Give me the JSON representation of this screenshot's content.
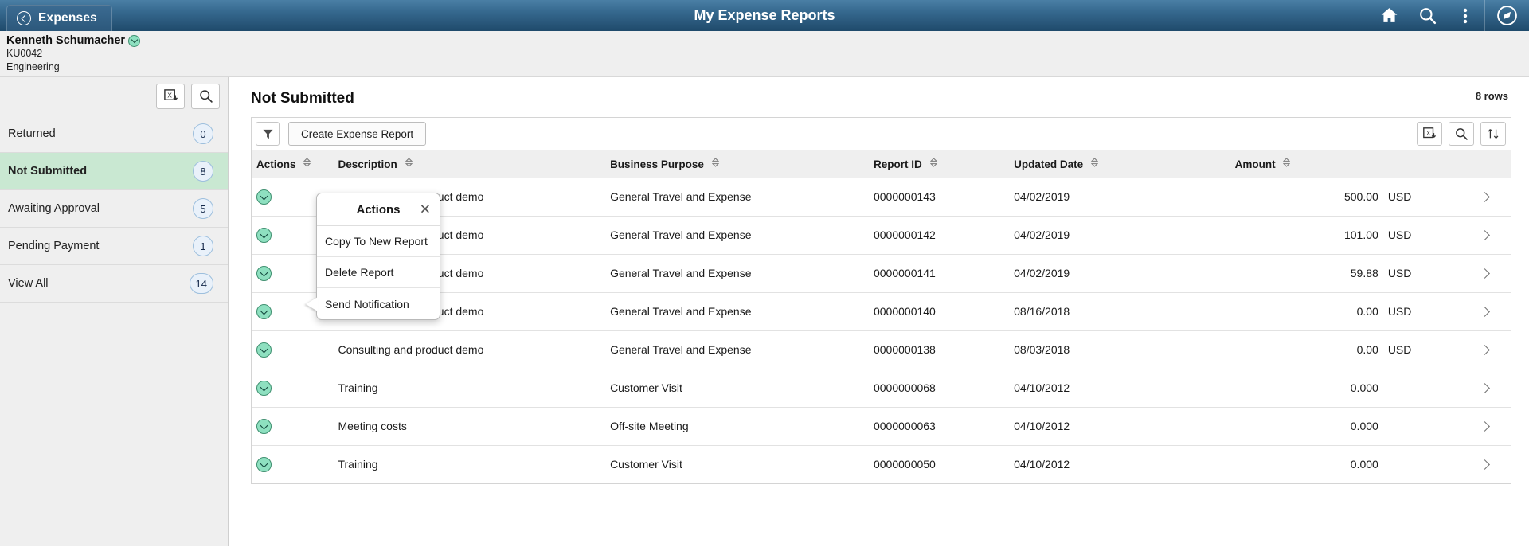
{
  "header": {
    "back_label": "Expenses",
    "title": "My Expense Reports",
    "icons": [
      "home-icon",
      "search-icon",
      "more-actions-icon",
      "navigator-icon"
    ]
  },
  "employee": {
    "name": "Kenneth Schumacher",
    "id": "KU0042",
    "department": "Engineering",
    "related_actions_icon": "related-actions-icon"
  },
  "sidebar": {
    "tools": [
      {
        "icon": "export-to-excel-icon"
      },
      {
        "icon": "search-icon"
      }
    ],
    "items": [
      {
        "label": "Returned",
        "count": "0",
        "active": false
      },
      {
        "label": "Not Submitted",
        "count": "8",
        "active": true
      },
      {
        "label": "Awaiting Approval",
        "count": "5",
        "active": false
      },
      {
        "label": "Pending Payment",
        "count": "1",
        "active": false
      },
      {
        "label": "View All",
        "count": "14",
        "active": false
      }
    ]
  },
  "main": {
    "title": "Not Submitted",
    "rows_label": "8 rows",
    "toolbar": {
      "filter_icon": "filter-funnel-icon",
      "create_label": "Create Expense Report",
      "right_icons": [
        "export-to-excel-icon",
        "search-icon",
        "sort-icon"
      ]
    },
    "columns": [
      {
        "key": "actions",
        "label": "Actions"
      },
      {
        "key": "desc",
        "label": "Description"
      },
      {
        "key": "purpose",
        "label": "Business Purpose"
      },
      {
        "key": "reportid",
        "label": "Report ID"
      },
      {
        "key": "date",
        "label": "Updated Date"
      },
      {
        "key": "amount",
        "label": "Amount"
      }
    ],
    "rows": [
      {
        "desc": "Consulting and product demo",
        "purpose": "General Travel and Expense",
        "reportid": "0000000143",
        "date": "04/02/2019",
        "amount": "500.00",
        "currency": "USD"
      },
      {
        "desc": "Consulting and product demo",
        "purpose": "General Travel and Expense",
        "reportid": "0000000142",
        "date": "04/02/2019",
        "amount": "101.00",
        "currency": "USD"
      },
      {
        "desc": "Consulting and product demo",
        "purpose": "General Travel and Expense",
        "reportid": "0000000141",
        "date": "04/02/2019",
        "amount": "59.88",
        "currency": "USD"
      },
      {
        "desc": "Consulting and product demo",
        "purpose": "General Travel and Expense",
        "reportid": "0000000140",
        "date": "08/16/2018",
        "amount": "0.00",
        "currency": "USD"
      },
      {
        "desc": "Consulting and product demo",
        "purpose": "General Travel and Expense",
        "reportid": "0000000138",
        "date": "08/03/2018",
        "amount": "0.00",
        "currency": "USD"
      },
      {
        "desc": "Training",
        "purpose": "Customer Visit",
        "reportid": "0000000068",
        "date": "04/10/2012",
        "amount": "0.000",
        "currency": ""
      },
      {
        "desc": "Meeting costs",
        "purpose": "Off-site Meeting",
        "reportid": "0000000063",
        "date": "04/10/2012",
        "amount": "0.000",
        "currency": ""
      },
      {
        "desc": "Training",
        "purpose": "Customer Visit",
        "reportid": "0000000050",
        "date": "04/10/2012",
        "amount": "0.000",
        "currency": ""
      }
    ]
  },
  "actions_popup": {
    "title": "Actions",
    "close_label": "✕",
    "items": [
      {
        "label": "Copy To New Report"
      },
      {
        "label": "Delete Report"
      },
      {
        "label": "Send Notification"
      }
    ]
  },
  "colors": {
    "header_blue": "#1f4a6b",
    "active_green": "#c9e8d2",
    "badge_green": "#8ee0c0",
    "pill_blue": "#e9f1fa"
  }
}
